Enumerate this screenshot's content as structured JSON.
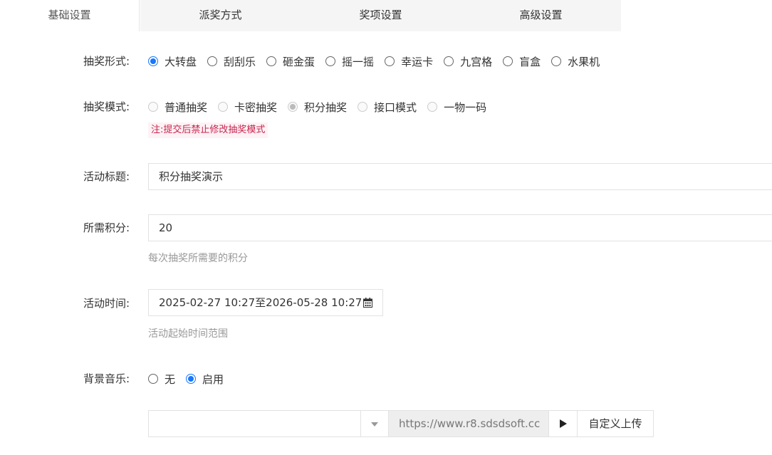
{
  "tabs": [
    {
      "label": "基础设置",
      "active": true
    },
    {
      "label": "派奖方式",
      "active": false
    },
    {
      "label": "奖项设置",
      "active": false
    },
    {
      "label": "高级设置",
      "active": false
    }
  ],
  "form": {
    "lottery_form": {
      "label": "抽奖形式:",
      "options": [
        "大转盘",
        "刮刮乐",
        "砸金蛋",
        "摇一摇",
        "幸运卡",
        "九宫格",
        "盲盒",
        "水果机"
      ],
      "selected": "大转盘"
    },
    "lottery_mode": {
      "label": "抽奖模式:",
      "options": [
        "普通抽奖",
        "卡密抽奖",
        "积分抽奖",
        "接口模式",
        "一物一码"
      ],
      "selected": "积分抽奖",
      "disabled": true,
      "note": "注:提交后禁止修改抽奖模式"
    },
    "activity_title": {
      "label": "活动标题:",
      "value": "积分抽奖演示"
    },
    "required_points": {
      "label": "所需积分:",
      "value": "20",
      "help": "每次抽奖所需要的积分"
    },
    "activity_time": {
      "label": "活动时间:",
      "value": "2025-02-27 10:27至2026-05-28 10:27",
      "help": "活动起始时间范围",
      "icon": "calendar-icon"
    },
    "background_music": {
      "label": "背景音乐:",
      "options": [
        "无",
        "启用"
      ],
      "selected": "启用",
      "select_value": "",
      "url": "https://www.r8.sdsdsoft.cc",
      "play_icon": "play-icon",
      "upload_label": "自定义上传"
    }
  },
  "colors": {
    "accent": "#1677ff",
    "note_text": "#c7254e",
    "note_bg": "#fdf2f5",
    "tab_bg": "#f5f5f5",
    "help_text": "#999999"
  }
}
